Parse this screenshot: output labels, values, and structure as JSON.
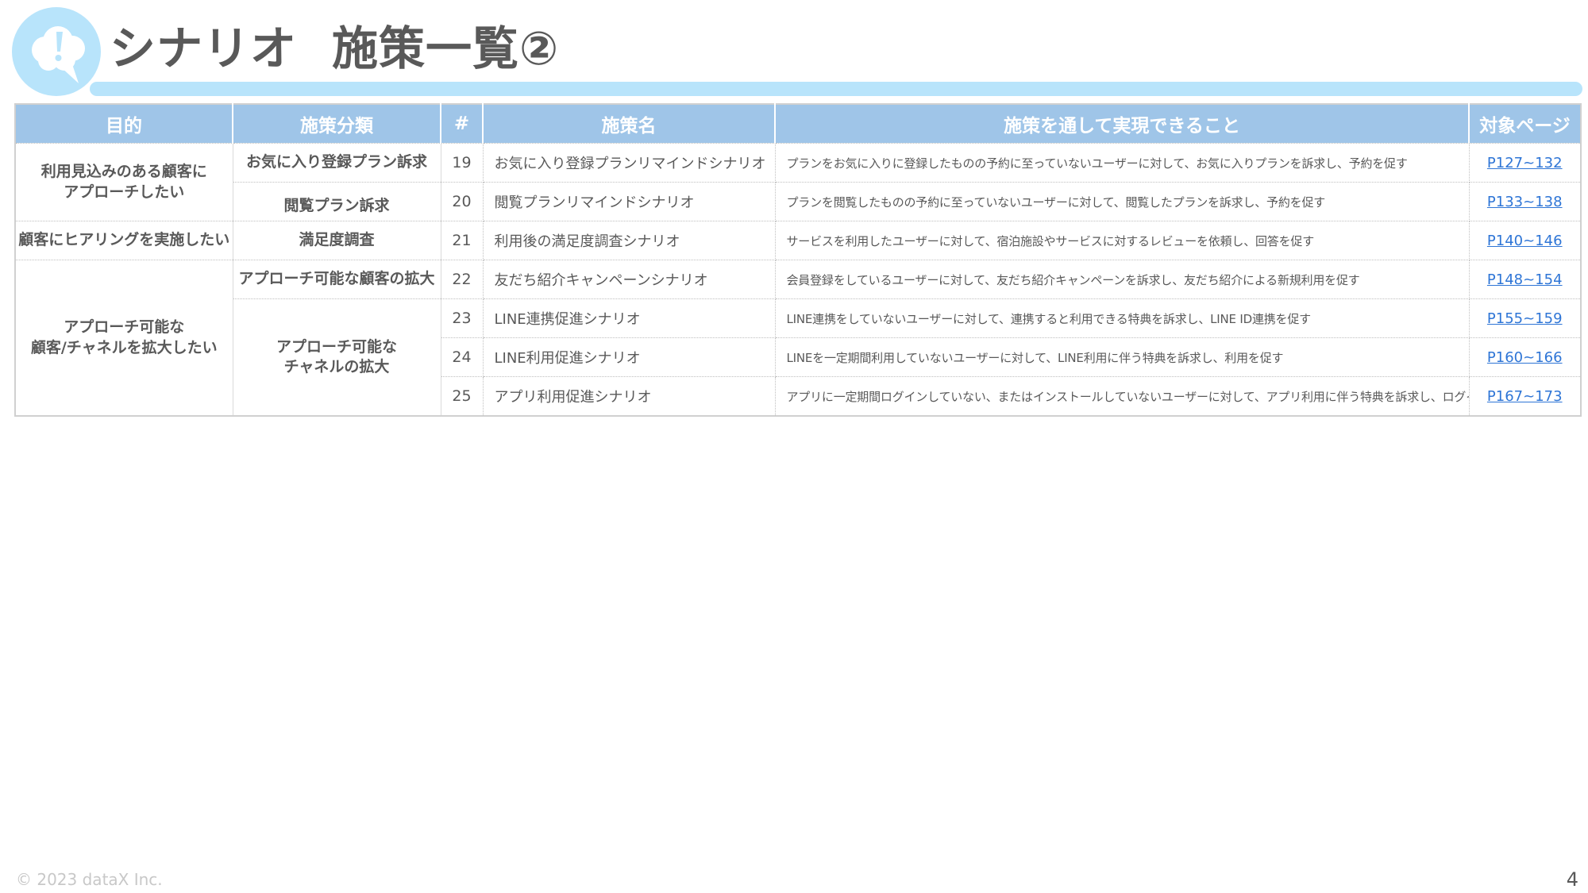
{
  "header": {
    "title_part1": "シナリオ",
    "title_part2": "施策一覧②",
    "logo_icon": "thinking-cloud-exclamation-icon",
    "accent_color": "#b8e4fb"
  },
  "table": {
    "header_color": "#9fc5e8",
    "link_color": "#2e75d6",
    "columns": [
      "目的",
      "施策分類",
      "#",
      "施策名",
      "施策を通して実現できること",
      "対象ページ"
    ],
    "groups": [
      {
        "purpose_line1": "利用見込みのある顧客に",
        "purpose_line2": "アプローチしたい"
      },
      {
        "purpose_line1": "顧客にヒアリングを実施したい"
      },
      {
        "purpose_line1": "アプローチ可能な",
        "purpose_line2": "顧客/チャネルを拡大したい"
      }
    ],
    "categories": [
      {
        "line1": "お気に入り登録プラン訴求"
      },
      {
        "line1": "閲覧プラン訴求"
      },
      {
        "line1": "満足度調査"
      },
      {
        "line1": "アプローチ可能な顧客の拡大"
      },
      {
        "line1": "アプローチ可能な",
        "line2": "チャネルの拡大"
      }
    ],
    "rows": [
      {
        "num": "19",
        "name": "お気に入り登録プランリマインドシナリオ",
        "desc": "プランをお気に入りに登録したものの予約に至っていないユーザーに対して、お気に入りプランを訴求し、予約を促す",
        "page": "P127~132"
      },
      {
        "num": "20",
        "name": "閲覧プランリマインドシナリオ",
        "desc": "プランを閲覧したものの予約に至っていないユーザーに対して、閲覧したプランを訴求し、予約を促す",
        "page": "P133~138"
      },
      {
        "num": "21",
        "name": "利用後の満足度調査シナリオ",
        "desc": "サービスを利用したユーザーに対して、宿泊施設やサービスに対するレビューを依頼し、回答を促す",
        "page": "P140~146"
      },
      {
        "num": "22",
        "name": "友だち紹介キャンペーンシナリオ",
        "desc": "会員登録をしているユーザーに対して、友だち紹介キャンペーンを訴求し、友だち紹介による新規利用を促す",
        "page": "P148~154"
      },
      {
        "num": "23",
        "name": "LINE連携促進シナリオ",
        "desc": "LINE連携をしていないユーザーに対して、連携すると利用できる特典を訴求し、LINE ID連携を促す",
        "page": "P155~159"
      },
      {
        "num": "24",
        "name": "LINE利用促進シナリオ",
        "desc": "LINEを一定期間利用していないユーザーに対して、LINE利用に伴う特典を訴求し、利用を促す",
        "page": "P160~166"
      },
      {
        "num": "25",
        "name": "アプリ利用促進シナリオ",
        "desc": "アプリに一定期間ログインしていない、またはインストールしていないユーザーに対して、アプリ利用に伴う特典を訴求し、ログインを促す",
        "page": "P167~173"
      }
    ]
  },
  "footer": {
    "copyright": "© 2023 dataX Inc.",
    "page_number": "4"
  }
}
